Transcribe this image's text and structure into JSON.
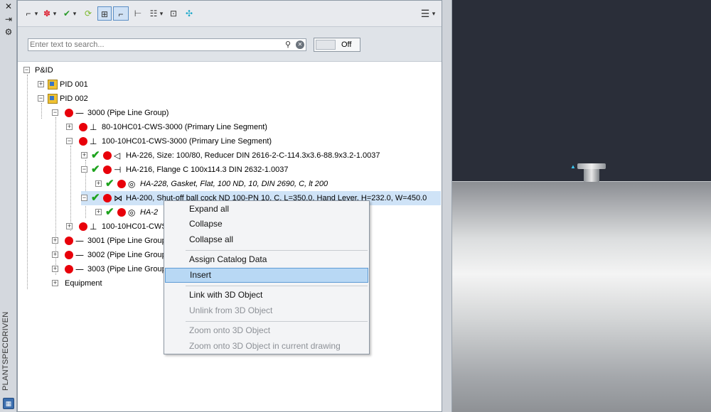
{
  "side_strip": {
    "close": "✕",
    "autohide": "⇥",
    "settings": "⚙",
    "title": "PLANTSPECDRIVEN"
  },
  "toolbar": {
    "menu_icon": "☰",
    "dropdown": "▾"
  },
  "search": {
    "placeholder": "Enter text to search...",
    "value": ""
  },
  "toggle": {
    "label": "Off"
  },
  "tree": {
    "root": "P&ID",
    "pid001": "PID 001",
    "pid002": "PID 002",
    "group3000": "3000 (Pipe Line Group)",
    "seg80": "80-10HC01-CWS-3000 (Primary Line Segment)",
    "seg100": "100-10HC01-CWS-3000 (Primary Line Segment)",
    "ha226": "HA-226, Size: 100/80, Reducer DIN 2616-2-C-114.3x3.6-88.9x3.2-1.0037",
    "ha216": "HA-216, Flange C 100x114.3 DIN 2632-1.0037",
    "ha228": "HA-228, Gasket, Flat, 100 ND, 10, DIN 2690, C, lt 200",
    "ha200": "HA-200, Shut-off ball cock ND 100-PN 10, C, L=350.0, Hand Lever, H=232.0, W=450.0",
    "ha2x": "HA-2",
    "seg100b": "100-10HC01-CWS",
    "group3001": "3001 (Pipe Line Group",
    "group3002": "3002 (Pipe Line Group",
    "group3003": "3003 (Pipe Line Group",
    "equipment": "Equipment"
  },
  "context_menu": {
    "expand_all": "Expand all",
    "collapse": "Collapse",
    "collapse_all": "Collapse all",
    "assign_catalog": "Assign Catalog Data",
    "insert": "Insert",
    "link_3d": "Link with 3D Object",
    "unlink_3d": "Unlink from 3D Object",
    "zoom_3d": "Zoom onto 3D Object",
    "zoom_3d_current": "Zoom onto 3D Object in current drawing"
  },
  "colors": {
    "status_red": "#e8000a",
    "check_green": "#1ea31e",
    "selection": "#b8d8f4"
  }
}
